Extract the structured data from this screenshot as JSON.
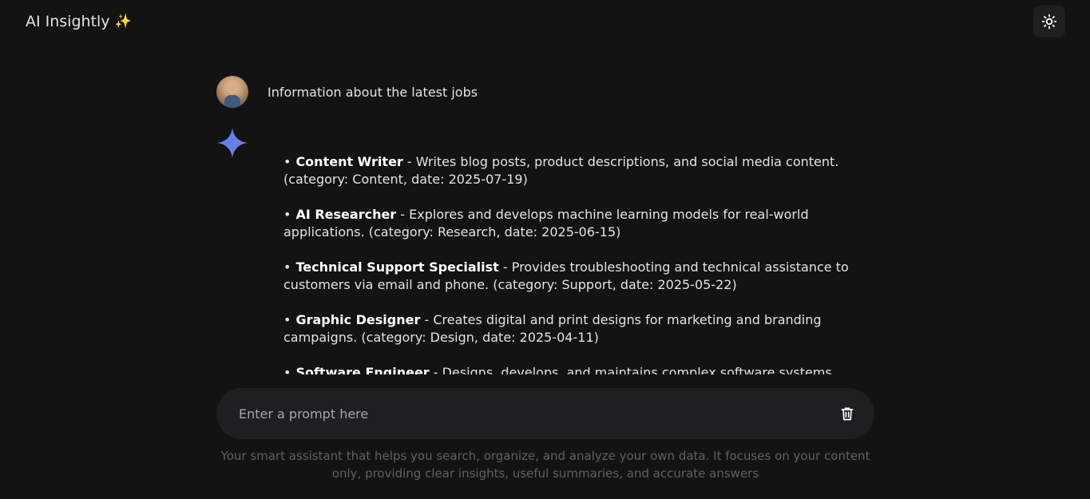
{
  "header": {
    "app_title": "AI Insightly",
    "title_emoji": "✨",
    "theme_toggle_icon": "sun-icon"
  },
  "conversation": {
    "user_message": "Information about the latest jobs",
    "ai_icon": "gemini-sparkle-icon",
    "jobs": [
      {
        "title": "Content Writer",
        "description": " - Writes blog posts, product descriptions, and social media content. (category: Content, date: 2025-07-19)"
      },
      {
        "title": "AI Researcher",
        "description": " - Explores and develops machine learning models for real-world applications. (category: Research, date: 2025-06-15)"
      },
      {
        "title": "Technical Support Specialist",
        "description": " - Provides troubleshooting and technical assistance to customers via email and phone. (category: Support, date: 2025-05-22)"
      },
      {
        "title": "Graphic Designer",
        "description": " - Creates digital and print designs for marketing and branding campaigns. (category: Design, date: 2025-04-11)"
      },
      {
        "title": "Software Engineer",
        "description": " - Designs, develops, and maintains complex software systems. (category:"
      }
    ]
  },
  "prompt": {
    "placeholder": "Enter a prompt here",
    "value": "",
    "clear_icon": "trash-icon"
  },
  "footer": {
    "note": "Your smart assistant that helps you search, organize, and analyze your own data. It focuses on your content only, providing clear insights, useful summaries, and accurate answers"
  },
  "colors": {
    "background": "#131314",
    "surface": "#1e1f20",
    "text": "#e3e3e3",
    "muted": "#5f6064",
    "sparkle_gradient": [
      "#4285f4",
      "#9b72cb"
    ]
  }
}
